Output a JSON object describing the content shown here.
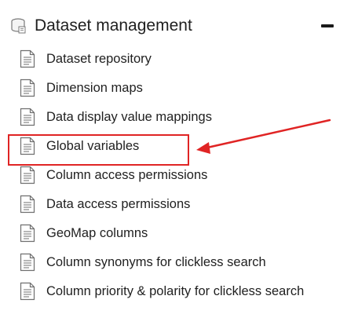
{
  "panel": {
    "title": "Dataset management",
    "collapse_symbol": "−",
    "header_icon": "database-icon",
    "item_icon": "document-icon",
    "items": [
      {
        "label": "Dataset repository"
      },
      {
        "label": "Dimension maps"
      },
      {
        "label": "Data display value mappings"
      },
      {
        "label": "Global variables"
      },
      {
        "label": "Column access permissions"
      },
      {
        "label": "Data access permissions"
      },
      {
        "label": "GeoMap columns"
      },
      {
        "label": "Column synonyms for clickless search"
      },
      {
        "label": "Column priority & polarity for clickless search"
      }
    ]
  },
  "annotation": {
    "highlighted_item": "Global variables",
    "highlight_color": "#e02424"
  }
}
